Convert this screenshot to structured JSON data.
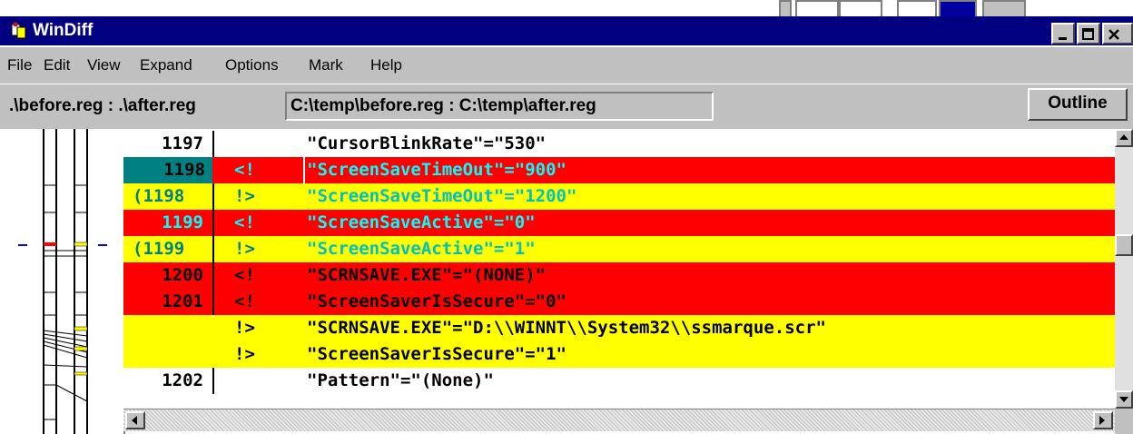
{
  "window": {
    "title": "WinDiff",
    "controls": [
      "minimize",
      "maximize",
      "close"
    ]
  },
  "menu": {
    "items": [
      {
        "label": "File"
      },
      {
        "label": "Edit"
      },
      {
        "label": "View"
      },
      {
        "label": "Expand"
      },
      {
        "label": "Options"
      },
      {
        "label": "Mark"
      },
      {
        "label": "Help"
      }
    ]
  },
  "pathbar": {
    "relative": ".\\before.reg : .\\after.reg",
    "absolute": "C:\\temp\\before.reg : C:\\temp\\after.reg",
    "outline_button": "Outline"
  },
  "colors": {
    "removed": "#ff0000",
    "added": "#ffff00",
    "current_line": "#008080",
    "text_changed": "#00ffff",
    "text_normal": "#000000",
    "title_bar": "#000080"
  },
  "diff": {
    "rows": [
      {
        "line": "1197",
        "mark": "",
        "text": "\"CursorBlinkRate\"=\"530\"",
        "state": "same"
      },
      {
        "line": "1198",
        "mark": "<!",
        "text": "\"ScreenSaveTimeOut\"=\"900\"",
        "state": "removed-current"
      },
      {
        "line": "(1198",
        "mark": "!>",
        "text": "\"ScreenSaveTimeOut\"=\"1200\"",
        "state": "added"
      },
      {
        "line": "1199",
        "mark": "<!",
        "text": "\"ScreenSaveActive\"=\"0\"",
        "state": "removed"
      },
      {
        "line": "(1199",
        "mark": "!>",
        "text": "\"ScreenSaveActive\"=\"1\"",
        "state": "added"
      },
      {
        "line": "1200",
        "mark": "<!",
        "text": "\"SCRNSAVE.EXE\"=\"(NONE)\"",
        "state": "removed-black"
      },
      {
        "line": "1201",
        "mark": "<!",
        "text": "\"ScreenSaverIsSecure\"=\"0\"",
        "state": "removed-black"
      },
      {
        "line": "",
        "mark": "!>",
        "text": "\"SCRNSAVE.EXE\"=\"D:\\\\WINNT\\\\System32\\\\ssmarque.scr\"",
        "state": "added-black"
      },
      {
        "line": "",
        "mark": "!>",
        "text": "\"ScreenSaverIsSecure\"=\"1\"",
        "state": "added-black"
      },
      {
        "line": "1202",
        "mark": "",
        "text": "\"Pattern\"=\"(None)\"",
        "state": "same"
      }
    ]
  },
  "icons": {
    "app": "windiff-app-icon",
    "scroll_up": "arrow-up-icon",
    "scroll_down": "arrow-down-icon",
    "scroll_left": "arrow-left-icon",
    "scroll_right": "arrow-right-icon"
  }
}
